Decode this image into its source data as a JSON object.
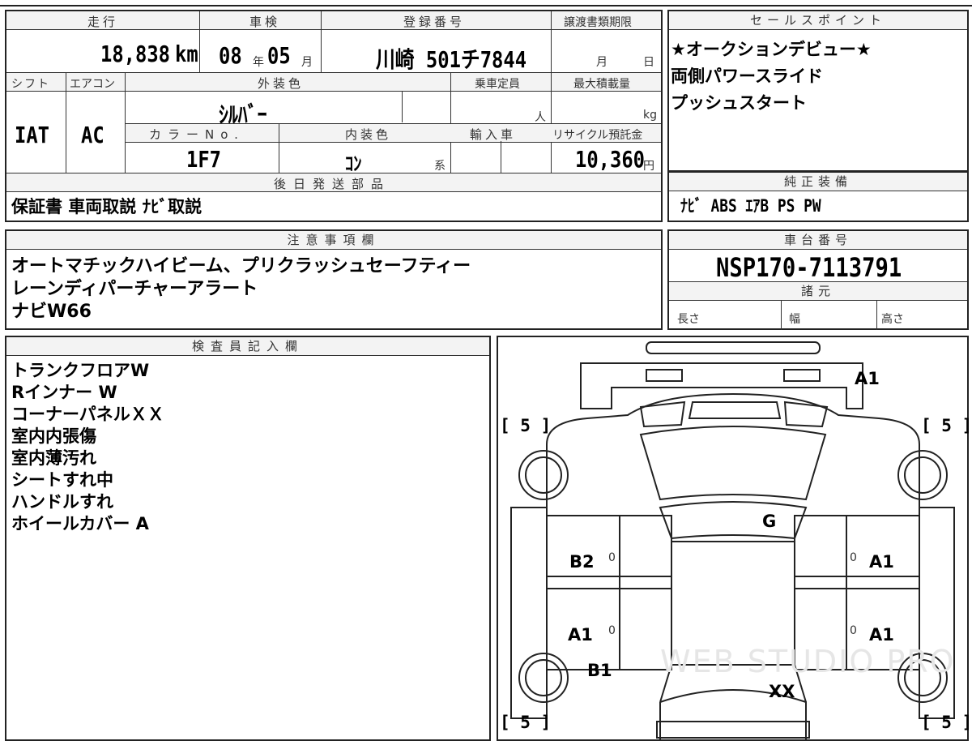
{
  "vehicle_info": {
    "labels": {
      "mileage": "走行",
      "inspection": "車検",
      "registration": "登録番号",
      "transfer_deadline": "譲渡書類期限",
      "shift": "シフト",
      "aircon": "エアコン",
      "exterior_color": "外装色",
      "capacity": "乗車定員",
      "max_load": "最大積載量",
      "color_no": "カラーNo.",
      "interior_color": "内装色",
      "import": "輸入車",
      "recycle_fee": "リサイクル預託金",
      "later_parts": "後日発送部品"
    },
    "mileage_value": "18,838",
    "mileage_unit": "km",
    "inspection_year": "08",
    "inspection_year_unit": "年",
    "inspection_month": "05",
    "inspection_month_unit": "月",
    "registration_number": "川崎 501チ7844",
    "transfer_month": "月",
    "transfer_day": "日",
    "shift_value": "IAT",
    "aircon_value": "AC",
    "exterior_color_value": "ｼﾙﾊﾞｰ",
    "capacity_unit": "人",
    "max_load_unit": "kg",
    "color_no_value": "1F7",
    "interior_color_value": "ｺﾝ",
    "interior_color_suffix": "系",
    "recycle_fee_value": "10,360",
    "recycle_fee_unit": "円",
    "later_parts_value": "保証書 車両取説 ﾅﾋﾞ取説"
  },
  "sales_points": {
    "header": "セールスポイント",
    "lines": [
      "★オークションデビュー★",
      "両側パワースライド",
      "プッシュスタート"
    ]
  },
  "genuine_equipment": {
    "header": "純正装備",
    "value": "ﾅﾋﾞ ABS ｴｱB PS PW"
  },
  "notes": {
    "header": "注意事項欄",
    "lines": [
      "オートマチックハイビーム、プリクラッシュセーフティー",
      "レーンディパーチャーアラート",
      "ナビW66"
    ]
  },
  "chassis": {
    "header": "車台番号",
    "value": "NSP170-7113791",
    "specs_header": "諸元",
    "length_label": "長さ",
    "width_label": "幅",
    "height_label": "高さ"
  },
  "inspector": {
    "header": "検査員記入欄",
    "lines": [
      "トランクフロアW",
      "Rインナー W",
      "コーナーパネルＸＸ",
      "室内内張傷",
      "室内薄汚れ",
      "シートすれ中",
      "ハンドルすれ",
      "ホイールカバー A"
    ]
  },
  "diagram": {
    "tire_tl": "[ 5 ]",
    "tire_tr": "[ 5 ]",
    "tire_bl": "[ 5 ]",
    "tire_br": "[ 5 ]",
    "rear_bumper": "A1",
    "roof": "G",
    "left_rear_door": "B2",
    "left_rear_door_z": "0",
    "right_rear_door": "A1",
    "right_rear_door_z": "0",
    "left_front_door": "A1",
    "left_front_door_z": "0",
    "right_front_door": "A1",
    "right_front_door_z": "0",
    "left_fender": "B1",
    "hood": "XX",
    "watermark": "WEB STUDIO PRO"
  }
}
